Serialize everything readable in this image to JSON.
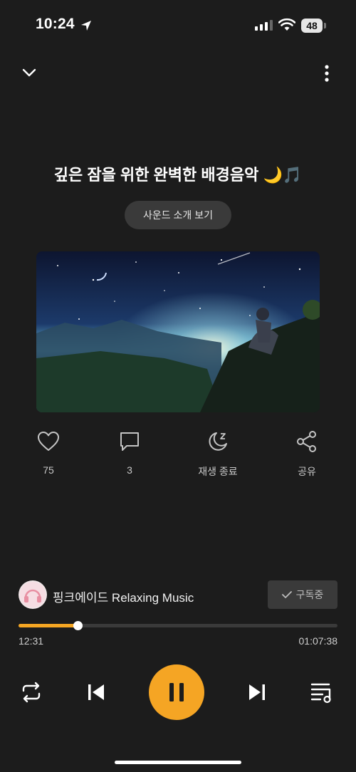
{
  "status": {
    "time": "10:24",
    "battery": "48"
  },
  "track": {
    "title": "깊은 잠을 위한 완벽한 배경음악 🌙🎵",
    "intro_button": "사운드 소개 보기"
  },
  "actions": {
    "likes": "75",
    "comments": "3",
    "sleep_timer": "재생 종료",
    "share": "공유"
  },
  "channel": {
    "name": "핑크에이드 Relaxing Music",
    "subscribe_label": "구독중"
  },
  "player": {
    "current_time": "12:31",
    "total_time": "01:07:38",
    "progress": 0.1851
  },
  "colors": {
    "accent": "#f5a524",
    "background": "#1c1c1c"
  }
}
